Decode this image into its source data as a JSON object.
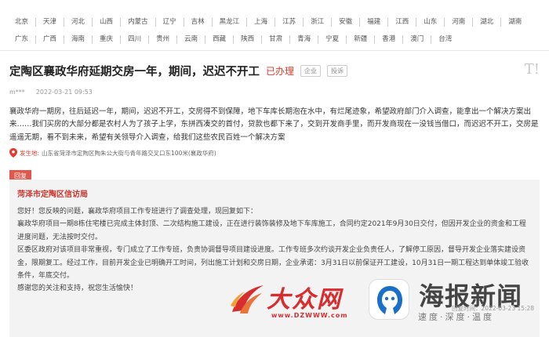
{
  "regions": {
    "row1": [
      "北京",
      "天津",
      "河北",
      "山西",
      "内蒙古",
      "辽宁",
      "吉林",
      "黑龙江",
      "上海",
      "江苏",
      "浙江",
      "安徽",
      "福建",
      "江西",
      "山东",
      "河南",
      "湖北",
      "湖南"
    ],
    "row2": [
      "广东",
      "广西",
      "海南",
      "重庆",
      "四川",
      "贵州",
      "云南",
      "西藏",
      "陕西",
      "甘肃",
      "青海",
      "宁夏",
      "新疆",
      "香港",
      "澳门",
      "台湾"
    ]
  },
  "article": {
    "title": "定陶区襄政华府延期交房一年，期间，迟迟不开工",
    "status": "已办理",
    "tags": [
      "企业",
      "投诉"
    ],
    "author": "m***",
    "date": "2022-03-21 09:53",
    "body": "襄政华府一期房，往后延迟一年，期间，迟迟不开工，交房得不到保障，地下车库长期泡在水中，有烂尾迹象，希望政府部门介入调查，能拿出一个解决方案出来……我们买房的大部分都是农村人为了孩子上学，东拼西凑交的首付，贷款也都下来了，交到开发商手里，而开发商现在一没钱当借口，而迟迟不开工，交房是遥遥无期，看不到未来，希望有关领导介入调查，给我们这些农民百姓一个解决方案",
    "location_label": "发生地:",
    "location": "山东省菏泽市定陶区陶朱公大街与青年路交叉口东100米(襄政华府)"
  },
  "reply": {
    "tab_label": "回复",
    "from": "菏泽市定陶区信访局",
    "paragraphs": [
      "您好！您反映的问题，襄政华府项目工作专班进行了调查处理，现回复如下：",
      "襄政华府项目一期8栋住宅楼已完成主体封顶、二次结构施工建设，正在进行装饰装修及地下车库施工，合同约定2021年9月30日交付，但因开发企业的资金和工程进度问题，无法按时交付。",
      "区委区政府对该项目非常重视，专门成立了工作专班，负责协调督导项目建设进度。工作专班多次约谈开发企业负责任人，了解停工原因，督导开发企业落实建设资金，限期复工。经过工作，目前开发企业已明确开工时间，列出施工计划和交房日期，企业承诺：3月31日以前保证开工建设，10月31日一期工程达到单体竣工验收条件，年底交付。",
      "感谢您的关注和支持，祝您生活愉快！"
    ],
    "reply_time": "回复时间：2022-03-23 15:28"
  },
  "watermarks": {
    "dzw_name": "大众网",
    "dzw_url": "www.DZWWW.com",
    "haibao_name": "海报新闻",
    "haibao_slogan": "速度·深度·温度"
  },
  "colors": {
    "accent": "#e23a2b",
    "reply_tab": "#e0574b",
    "reply_bg": "#f3f3f3"
  }
}
